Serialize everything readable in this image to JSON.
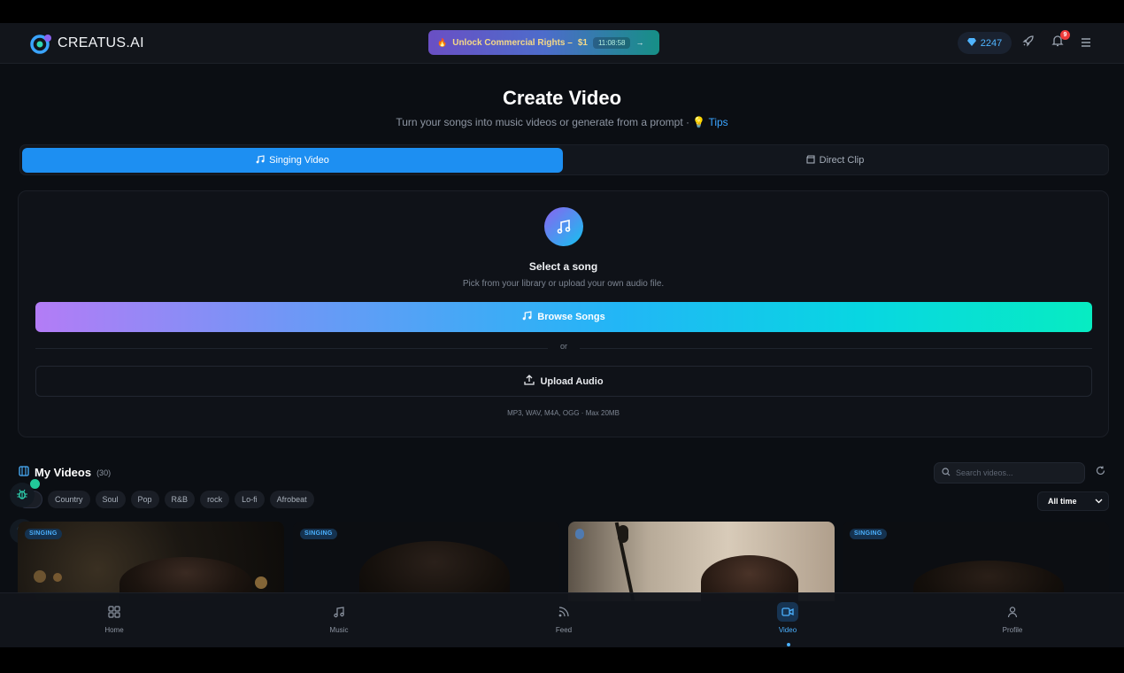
{
  "header": {
    "logo_text": "CREATUS.AI",
    "promo_text": "Unlock Commercial Rights –",
    "promo_price": "$1",
    "promo_timer": "11:08:58",
    "credits": "2247",
    "notifications_count": "9"
  },
  "page": {
    "title": "Create Video",
    "subtitle": "Turn your songs into music videos or generate from a prompt ·",
    "tips_label": "Tips"
  },
  "tabs": [
    {
      "label": "Singing Video",
      "active": true
    },
    {
      "label": "Direct Clip",
      "active": false
    }
  ],
  "card": {
    "title": "Select a song",
    "subtitle": "Pick from your library or upload your own audio file.",
    "browse_label": "Browse Songs",
    "or_label": "or",
    "upload_label": "Upload Audio",
    "formats": "MP3, WAV, M4A, OGG · Max 20MB"
  },
  "my_videos": {
    "title": "My Videos",
    "count": "(30)",
    "search_placeholder": "Search videos...",
    "time_filter": "All time",
    "genres": [
      "Country",
      "Soul",
      "Pop",
      "R&B",
      "rock",
      "Lo-fi",
      "Afrobeat"
    ],
    "videos": [
      {
        "tag": "SINGING"
      },
      {
        "tag": "SINGING"
      },
      {
        "tag": ""
      },
      {
        "tag": "SINGING"
      }
    ]
  },
  "bottom_nav": [
    {
      "label": "Home",
      "icon": "grid-icon",
      "active": false
    },
    {
      "label": "Music",
      "icon": "music-icon",
      "active": false
    },
    {
      "label": "Feed",
      "icon": "rss-icon",
      "active": false
    },
    {
      "label": "Video",
      "icon": "video-icon",
      "active": true
    },
    {
      "label": "Profile",
      "icon": "user-icon",
      "active": false
    }
  ],
  "colors": {
    "accent": "#1d8ff2",
    "background": "#0b0e13",
    "badge": "#ef3b3b"
  }
}
